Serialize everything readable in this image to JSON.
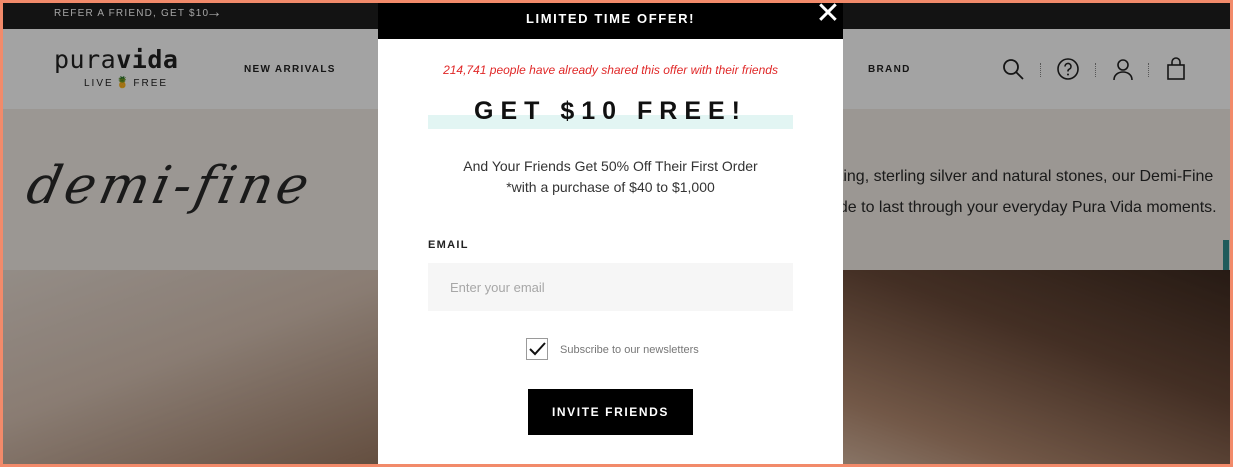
{
  "announcement": {
    "text": "REFER A FRIEND, GET $10",
    "arrow": "→"
  },
  "header": {
    "logo": {
      "brand_light": "pura",
      "brand_bold": "vida",
      "tag_left": "LIVE",
      "tag_right": "FREE",
      "pineapple": "🍍"
    },
    "nav": {
      "new_arrivals": "NEW ARRIVALS",
      "brand": "BRAND"
    },
    "icons": [
      "search-icon",
      "help-icon",
      "account-icon",
      "cart-icon"
    ]
  },
  "hero": {
    "script_title": "demi-fine",
    "copy_line1": "ating, sterling silver and natural stones, our Demi-Fine",
    "copy_line2": "ade to last through your everyday Pura Vida moments."
  },
  "modal": {
    "title": "LIMITED TIME OFFER!",
    "close_symbol": "✕",
    "social_proof": "214,741 people have already shared this offer with their friends",
    "headline": "GET $10 FREE!",
    "subtext1": "And Your Friends Get 50% Off Their First Order",
    "subtext2": "*with a purchase of $40 to $1,000",
    "email_label": "EMAIL",
    "email_placeholder": "Enter your email",
    "email_value": "",
    "newsletter_checked": true,
    "newsletter_label": "Subscribe to our newsletters",
    "button_label": "INVITE FRIENDS"
  },
  "colors": {
    "overlay": "rgba(0,0,0,0.36)",
    "social_proof": "#e02828",
    "headline_band": "#e2f5f3",
    "frame_border": "#f28a6a",
    "teal_accent": "#2f8f8f"
  }
}
